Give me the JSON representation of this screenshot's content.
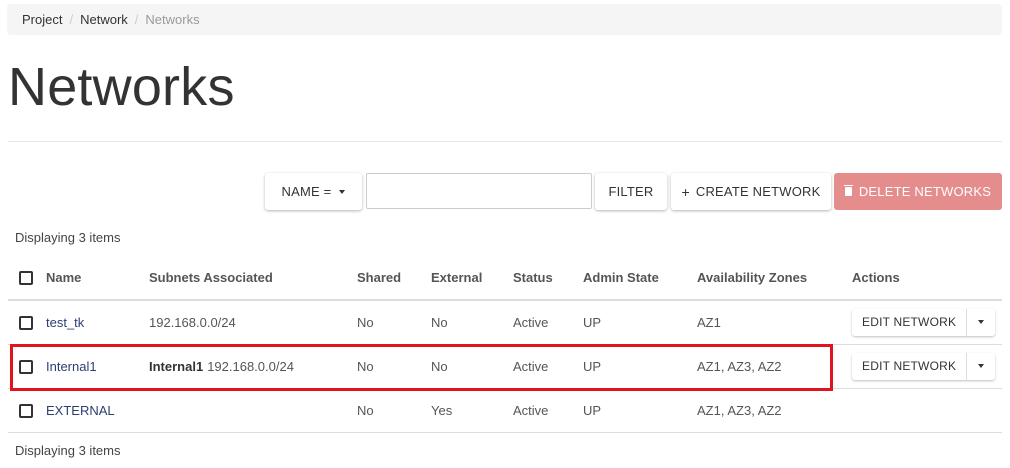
{
  "breadcrumb": [
    "Project",
    "Network",
    "Networks"
  ],
  "page_title": "Networks",
  "toolbar": {
    "filter_select": "NAME =",
    "filter_input_value": "",
    "filter_button": "FILTER",
    "create_button": "CREATE NETWORK",
    "delete_button": "DELETE NETWORKS"
  },
  "displaying_text": "Displaying 3 items",
  "table": {
    "columns": [
      "Name",
      "Subnets Associated",
      "Shared",
      "External",
      "Status",
      "Admin State",
      "Availability Zones",
      "Actions"
    ],
    "rows": [
      {
        "name": "test_tk",
        "subnet_name": "",
        "subnet_cidr": "192.168.0.0/24",
        "shared": "No",
        "external": "No",
        "status": "Active",
        "admin_state": "UP",
        "zones": "AZ1",
        "action": "EDIT NETWORK"
      },
      {
        "name": "Internal1",
        "subnet_name": "Internal1",
        "subnet_cidr": "192.168.0.0/24",
        "shared": "No",
        "external": "No",
        "status": "Active",
        "admin_state": "UP",
        "zones": "AZ1, AZ3, AZ2",
        "action": "EDIT NETWORK"
      },
      {
        "name": "EXTERNAL",
        "subnet_name": "",
        "subnet_cidr": "",
        "shared": "No",
        "external": "Yes",
        "status": "Active",
        "admin_state": "UP",
        "zones": "AZ1, AZ3, AZ2",
        "action": ""
      }
    ]
  },
  "colors": {
    "delete_button_bg": "#e58d8c",
    "link": "#2c3e72",
    "highlight": "#e0141e"
  }
}
